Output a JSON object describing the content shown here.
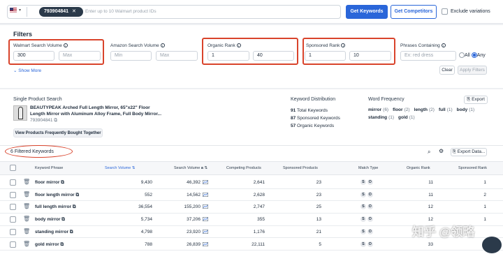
{
  "topbar": {
    "product_id": "793904841",
    "id_placeholder": "Enter up to 10 Walmart product IDs",
    "get_keywords_label": "Get Keywords",
    "get_competitors_label": "Get Competitors",
    "exclude_variations_label": "Exclude variations"
  },
  "filters": {
    "title": "Filters",
    "walmart_search_volume": {
      "label": "Walmart Search Volume",
      "min": "300",
      "max_placeholder": "Max"
    },
    "amazon_search_volume": {
      "label": "Amazon Search Volume",
      "min_placeholder": "Min",
      "max_placeholder": "Max"
    },
    "organic_rank": {
      "label": "Organic Rank",
      "min": "1",
      "max": "40"
    },
    "sponsored_rank": {
      "label": "Sponsored Rank",
      "min": "1",
      "max": "10"
    },
    "phrases_containing": {
      "label": "Phrases Containing",
      "placeholder": "Ex: red dress",
      "all_label": "All",
      "any_label": "Any"
    },
    "show_more_label": "Show More",
    "clear_label": "Clear",
    "apply_label": "Apply Filters"
  },
  "product": {
    "section_title": "Single Product Search",
    "name_line1": "BEAUTYPEAK Arched Full Length Mirror, 65\"x22\" Floor",
    "name_line2": "Length Mirror with Aluminum Alloy Frame, Full Body Mirror...",
    "id": "793904841",
    "fbt_label": "View Products Frequently Bought Together"
  },
  "distribution": {
    "title": "Keyword Distribution",
    "items": [
      {
        "count": "91",
        "label": "Total Keywords"
      },
      {
        "count": "87",
        "label": "Sponsored Keywords"
      },
      {
        "count": "57",
        "label": "Organic Keywords"
      }
    ]
  },
  "word_frequency": {
    "title": "Word Frequency",
    "export_label": "Export",
    "line1": [
      {
        "word": "mirror",
        "count": "(6)"
      },
      {
        "word": "floor",
        "count": "(2)"
      },
      {
        "word": "length",
        "count": "(2)"
      },
      {
        "word": "full",
        "count": "(1)"
      },
      {
        "word": "body",
        "count": "(1)"
      }
    ],
    "line2": [
      {
        "word": "standing",
        "count": "(1)"
      },
      {
        "word": "gold",
        "count": "(1)"
      }
    ]
  },
  "results": {
    "count_label": "6 Filtered Keywords",
    "export_data_label": "Export Data..."
  },
  "table": {
    "headers": {
      "phrase": "Keyword Phrase",
      "search_volume": "Search Volume",
      "search_volume_a": "Search Volume",
      "competing": "Competing Products",
      "sponsored_products": "Sponsored Products",
      "match_type": "Match Type",
      "organic_rank": "Organic Rank",
      "sponsored_rank": "Sponsored Rank"
    },
    "rows": [
      {
        "phrase": "floor mirror",
        "sv": "9,430",
        "sva": "46,392",
        "competing": "2,641",
        "sp": "23",
        "s": "S",
        "o": "O",
        "organic": "11",
        "sponsored": "1"
      },
      {
        "phrase": "floor length mirror",
        "sv": "552",
        "sva": "14,562",
        "competing": "2,628",
        "sp": "23",
        "s": "S",
        "o": "O",
        "organic": "11",
        "sponsored": "2"
      },
      {
        "phrase": "full length mirror",
        "sv": "36,554",
        "sva": "155,200",
        "competing": "2,747",
        "sp": "25",
        "s": "S",
        "o": "O",
        "organic": "12",
        "sponsored": "1"
      },
      {
        "phrase": "body mirror",
        "sv": "5,734",
        "sva": "37,206",
        "competing": "355",
        "sp": "13",
        "s": "S",
        "o": "O",
        "organic": "12",
        "sponsored": "1"
      },
      {
        "phrase": "standing mirror",
        "sv": "4,798",
        "sva": "23,920",
        "competing": "1,176",
        "sp": "21",
        "s": "S",
        "o": "O",
        "organic": "",
        "sponsored": ""
      },
      {
        "phrase": "gold mirror",
        "sv": "788",
        "sva": "26,839",
        "competing": "22,111",
        "sp": "5",
        "s": "S",
        "o": "O",
        "organic": "33",
        "sponsored": ""
      }
    ]
  },
  "watermark": "知乎 @领略"
}
